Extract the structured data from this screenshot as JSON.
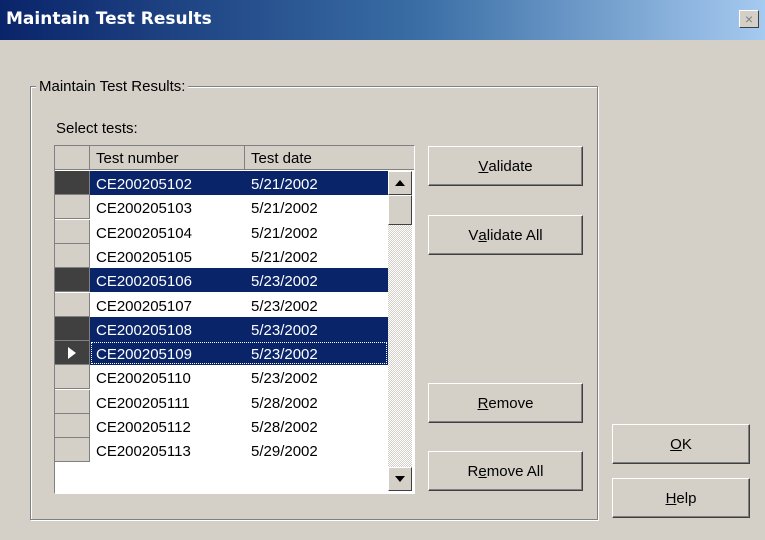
{
  "window": {
    "title": "Maintain Test Results",
    "close_glyph": "×"
  },
  "group": {
    "label": "Maintain Test Results:"
  },
  "select_label": "Select tests:",
  "grid": {
    "columns": [
      "Test number",
      "Test date"
    ],
    "rows": [
      {
        "number": "CE200205102",
        "date": "5/21/2002",
        "selected": true
      },
      {
        "number": "CE200205103",
        "date": "5/21/2002",
        "selected": false
      },
      {
        "number": "CE200205104",
        "date": "5/21/2002",
        "selected": false
      },
      {
        "number": "CE200205105",
        "date": "5/21/2002",
        "selected": false
      },
      {
        "number": "CE200205106",
        "date": "5/23/2002",
        "selected": true
      },
      {
        "number": "CE200205107",
        "date": "5/23/2002",
        "selected": false
      },
      {
        "number": "CE200205108",
        "date": "5/23/2002",
        "selected": true
      },
      {
        "number": "CE200205109",
        "date": "5/23/2002",
        "selected": true,
        "current": true
      },
      {
        "number": "CE200205110",
        "date": "5/23/2002",
        "selected": false
      },
      {
        "number": "CE200205111",
        "date": "5/28/2002",
        "selected": false
      },
      {
        "number": "CE200205112",
        "date": "5/28/2002",
        "selected": false
      },
      {
        "number": "CE200205113",
        "date": "5/29/2002",
        "selected": false
      }
    ]
  },
  "buttons": {
    "validate": {
      "pre": "",
      "key": "V",
      "post": "alidate"
    },
    "validate_all": {
      "pre": "V",
      "key": "a",
      "post": "lidate All"
    },
    "remove": {
      "pre": "",
      "key": "R",
      "post": "emove"
    },
    "remove_all": {
      "pre": "R",
      "key": "e",
      "post": "move All"
    },
    "ok": {
      "pre": "",
      "key": "O",
      "post": "K"
    },
    "help": {
      "pre": "",
      "key": "H",
      "post": "elp"
    }
  },
  "colors": {
    "selection": "#0a246a",
    "face": "#d4d0c8"
  },
  "icons": {
    "up": "scroll-up-arrow-icon",
    "down": "scroll-down-arrow-icon",
    "current_row": "current-row-pointer-icon"
  }
}
